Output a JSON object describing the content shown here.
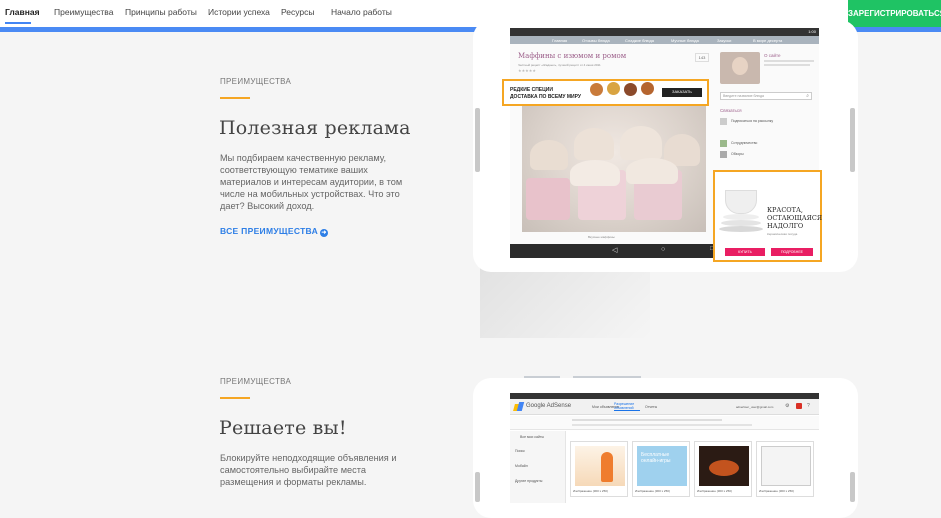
{
  "nav": {
    "items": [
      "Главная",
      "Преимущества",
      "Принципы работы",
      "Истории успеха",
      "Ресурсы",
      "Начало работы"
    ],
    "signup_label": "ЗАРЕГИСТРИРОВАТЬСЯ"
  },
  "section1": {
    "eyebrow": "ПРЕИМУЩЕСТВА",
    "title": "Полезная реклама",
    "body": "Мы подбираем качественную рекламу, соответствующую тематике ваших материалов и интересам аудитории, в том числе на мобильных устройствах. Что это дает? Высокий доход.",
    "link": "ВСЕ ПРЕИМУЩЕСТВА",
    "device": {
      "status_time": "1:00",
      "site_nav": [
        "Главная",
        "Отзывы блюда",
        "Сладкие блюда",
        "Мучные блюда",
        "Закуски",
        "В мире десерта"
      ],
      "post_title": "Маффины с изюмом и ромом",
      "post_meta": "Честный рецепт «Жадных», лучший рецепт от 4 июня 2011",
      "post_stars": "★★★★★",
      "comment_count": "143",
      "image_caption": "Вкусные маффины",
      "about_title": "О сайте",
      "search_placeholder": "Введите название блюда",
      "subscribe_title": "Связаться",
      "subscribe_items": [
        "Подписаться на рассылку",
        "Сотрудничество",
        "Обзоры"
      ],
      "ad_banner": {
        "line1": "РЕДКИЕ СПЕЦИИ",
        "line2": "ДОСТАВКА ПО ВСЕМУ МИРУ",
        "button": "ЗАКАЗАТЬ"
      },
      "ad_square": {
        "text1": "КРАСОТА,",
        "text2": "ОСТАЮЩАЯСЯ",
        "text3": "НАДОЛГО",
        "sub": "Керамическая посуда",
        "btn1": "КУПИТЬ",
        "btn2": "ПОДРОБНЕЕ"
      }
    }
  },
  "section2": {
    "eyebrow": "ПРЕИМУЩЕСТВА",
    "title": "Решаете вы!",
    "body": "Блокируйте неподходящие объявления и самостоятельно выбирайте места размещения и форматы рекламы.",
    "device": {
      "app_name": "Google AdSense",
      "user": "advertiser_user@gmail.com",
      "tabs": [
        "Мои объявления",
        "Разрешение объявлений",
        "Отчеты"
      ],
      "sidebar": [
        "Все мои сайты",
        "Поиск",
        "Мобайл",
        "Другие продукты"
      ],
      "cards": [
        {
          "caption": "Изображение (300 х 250)"
        },
        {
          "caption": "Изображение (300 х 250)"
        },
        {
          "caption": "Изображение (300 х 250)"
        },
        {
          "caption": "Изображение (300 х 250)"
        }
      ],
      "card2_text": "Бесплатные онлайн-игры"
    }
  },
  "colors": {
    "accent_blue": "#4a8af4",
    "signup_green": "#1fc364",
    "eyebrow_bar": "#f5a623",
    "ad_border": "#f5a623"
  }
}
